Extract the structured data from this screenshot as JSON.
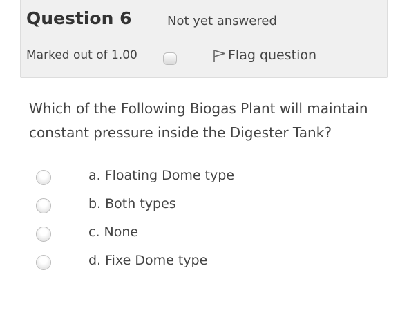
{
  "question_info": {
    "label_prefix": "Question",
    "number": "6",
    "state": "Not yet answered",
    "grade": "Marked out of 1.00",
    "flag_label": "Flag question"
  },
  "question": {
    "text": "Which of the Following Biogas Plant will maintain constant pressure inside the Digester Tank?"
  },
  "answers": [
    {
      "label": "a. Floating Dome type",
      "selected": false
    },
    {
      "label": "b. Both types",
      "selected": false
    },
    {
      "label": "c. None",
      "selected": false
    },
    {
      "label": "d. Fixe Dome type",
      "selected": false
    }
  ]
}
